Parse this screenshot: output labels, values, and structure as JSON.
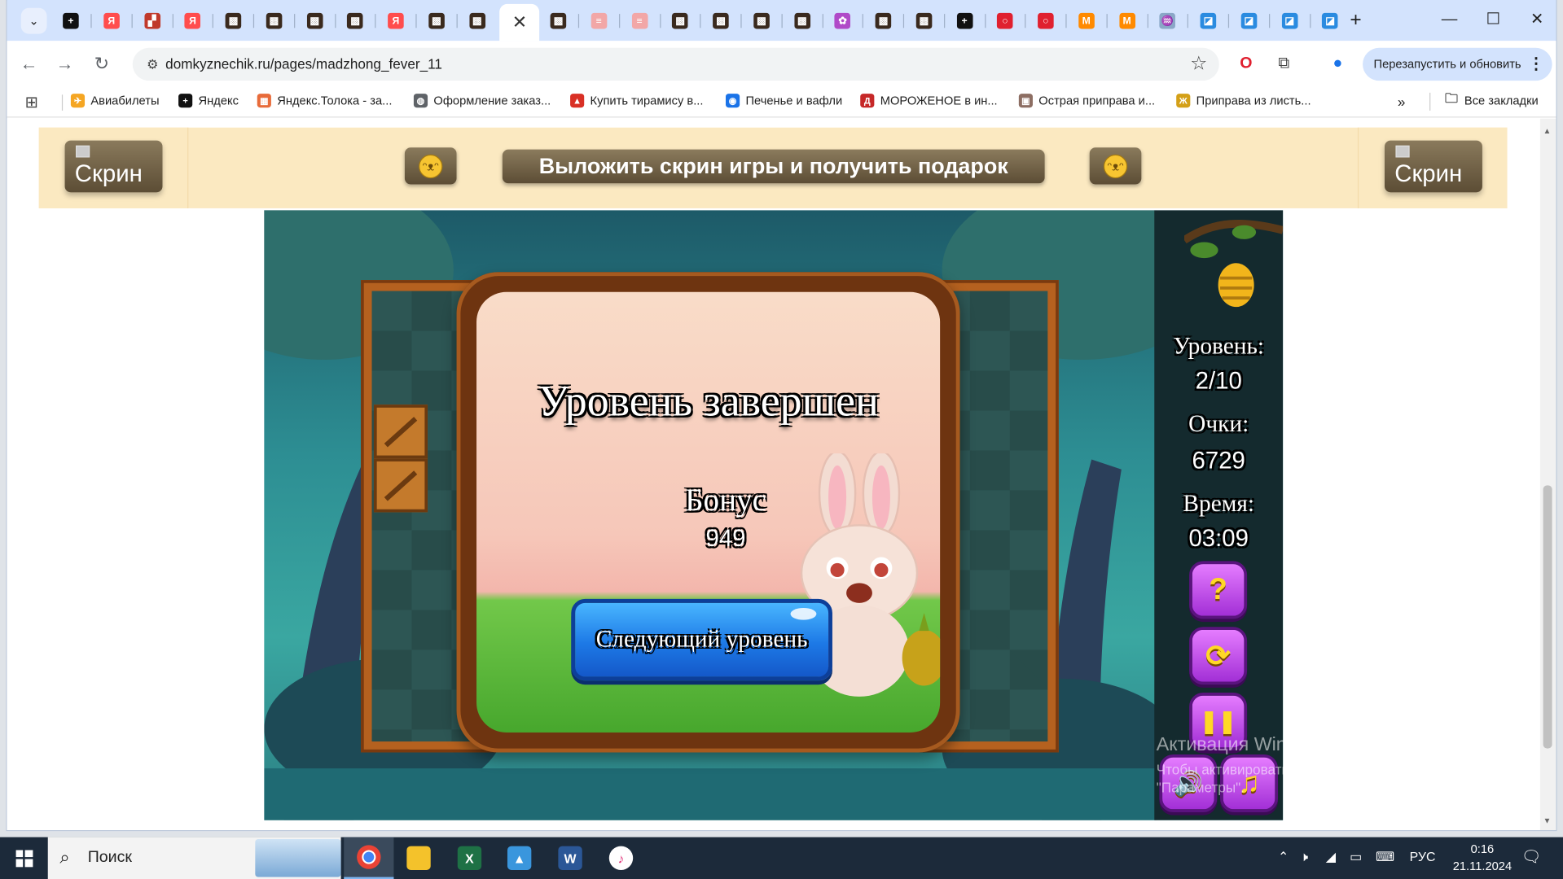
{
  "browser": {
    "tabs": [
      {
        "icon": "black-plus-icon",
        "color": "#111111",
        "glyph": "+"
      },
      {
        "icon": "yandex-icon",
        "color": "#ff4d4d",
        "glyph": "Я"
      },
      {
        "icon": "puzzle-red-icon",
        "color": "#c0392b",
        "glyph": "▞"
      },
      {
        "icon": "yandex-icon",
        "color": "#ff4d4d",
        "glyph": "Я"
      },
      {
        "icon": "game-icon",
        "color": "#3a2a1e",
        "glyph": "▩"
      },
      {
        "icon": "game-icon",
        "color": "#3a2a1e",
        "glyph": "▩"
      },
      {
        "icon": "game-icon",
        "color": "#3a2a1e",
        "glyph": "▩"
      },
      {
        "icon": "game-icon",
        "color": "#3a2a1e",
        "glyph": "▩"
      },
      {
        "icon": "yandex-icon",
        "color": "#ff4d4d",
        "glyph": "Я"
      },
      {
        "icon": "game-icon",
        "color": "#3a2a1e",
        "glyph": "▩"
      },
      {
        "icon": "game-icon",
        "color": "#3a2a1e",
        "glyph": "▩"
      },
      {
        "icon": "close-tab-icon",
        "color": "#ffffff",
        "glyph": "✕",
        "active": true
      },
      {
        "icon": "game-icon",
        "color": "#3a2a1e",
        "glyph": "▩"
      },
      {
        "icon": "cake-icon",
        "color": "#f2a7a7",
        "glyph": "≡"
      },
      {
        "icon": "cake-icon",
        "color": "#f2a7a7",
        "glyph": "≡"
      },
      {
        "icon": "game-icon",
        "color": "#3a2a1e",
        "glyph": "▩"
      },
      {
        "icon": "game-icon",
        "color": "#3a2a1e",
        "glyph": "▩"
      },
      {
        "icon": "game-icon",
        "color": "#3a2a1e",
        "glyph": "▩"
      },
      {
        "icon": "game-icon",
        "color": "#3a2a1e",
        "glyph": "▩"
      },
      {
        "icon": "flower-icon",
        "color": "#b04ac8",
        "glyph": "✿"
      },
      {
        "icon": "game-icon",
        "color": "#3a2a1e",
        "glyph": "▩"
      },
      {
        "icon": "game-icon",
        "color": "#3a2a1e",
        "glyph": "▩"
      },
      {
        "icon": "black-plus-icon",
        "color": "#111111",
        "glyph": "+"
      },
      {
        "icon": "opera-icon",
        "color": "#e0202f",
        "glyph": "○"
      },
      {
        "icon": "opera-icon",
        "color": "#e0202f",
        "glyph": "○"
      },
      {
        "icon": "market-icon",
        "color": "#ff8a00",
        "glyph": "M"
      },
      {
        "icon": "market-icon",
        "color": "#ff8a00",
        "glyph": "M"
      },
      {
        "icon": "blue-app-icon",
        "color": "#8aa7c7",
        "glyph": "♒"
      },
      {
        "icon": "window-icon",
        "color": "#2a8be0",
        "glyph": "◪"
      },
      {
        "icon": "window-icon",
        "color": "#2a8be0",
        "glyph": "◪"
      },
      {
        "icon": "window-icon",
        "color": "#2a8be0",
        "glyph": "◪"
      },
      {
        "icon": "window-icon",
        "color": "#2a8be0",
        "glyph": "◪"
      }
    ],
    "new_tab": "+",
    "url": "domkyznechik.ru/pages/madzhong_fever_11",
    "relaunch_label": "Перезапустить и обновить",
    "bookmarks": [
      {
        "label": "Авиабилеты",
        "color": "#f5a623",
        "glyph": "✈"
      },
      {
        "label": "Яндекс",
        "color": "#111111",
        "glyph": "+"
      },
      {
        "label": "Яндекс.Толока - за...",
        "color": "#e86b3a",
        "glyph": "▦"
      },
      {
        "label": "Оформление заказ...",
        "color": "#5f6368",
        "glyph": "◍"
      },
      {
        "label": "Купить тирамису в...",
        "color": "#d93025",
        "glyph": "▲"
      },
      {
        "label": "Печенье и вафли",
        "color": "#1a73e8",
        "glyph": "◉"
      },
      {
        "label": "МОРОЖЕНОЕ в ин...",
        "color": "#c62828",
        "glyph": "Д"
      },
      {
        "label": "Острая приправа и...",
        "color": "#8d6e63",
        "glyph": "▣"
      },
      {
        "label": "Приправа из листь...",
        "color": "#d4a017",
        "glyph": "Ж"
      }
    ],
    "all_bookmarks": "Все закладки"
  },
  "banner": {
    "skrin_left": "Скрин",
    "skrin_right": "Скрин",
    "upload_label": "Выложить скрин игры и получить подарок"
  },
  "game": {
    "dialog_title": "Уровень завершен",
    "bonus_label": "Бонус",
    "bonus_value": "949",
    "next_button": "Следующий уровень",
    "level_label": "Уровень:",
    "level_value": "2/10",
    "score_label": "Очки:",
    "score_value": "6729",
    "time_label": "Время:",
    "time_value": "03:09",
    "buttons": {
      "help": "?",
      "restart": "⟳",
      "pause": "❚❚",
      "sound": "🔊",
      "music": "♫"
    }
  },
  "watermark": {
    "line1": "Активация Windows",
    "line2": "Чтобы активировать Windows, перейдите в раздел",
    "line3": "\"Параметры\"."
  },
  "taskbar": {
    "search_label": "Поиск",
    "lang": "РУС",
    "time": "0:16",
    "date": "21.11.2024"
  }
}
